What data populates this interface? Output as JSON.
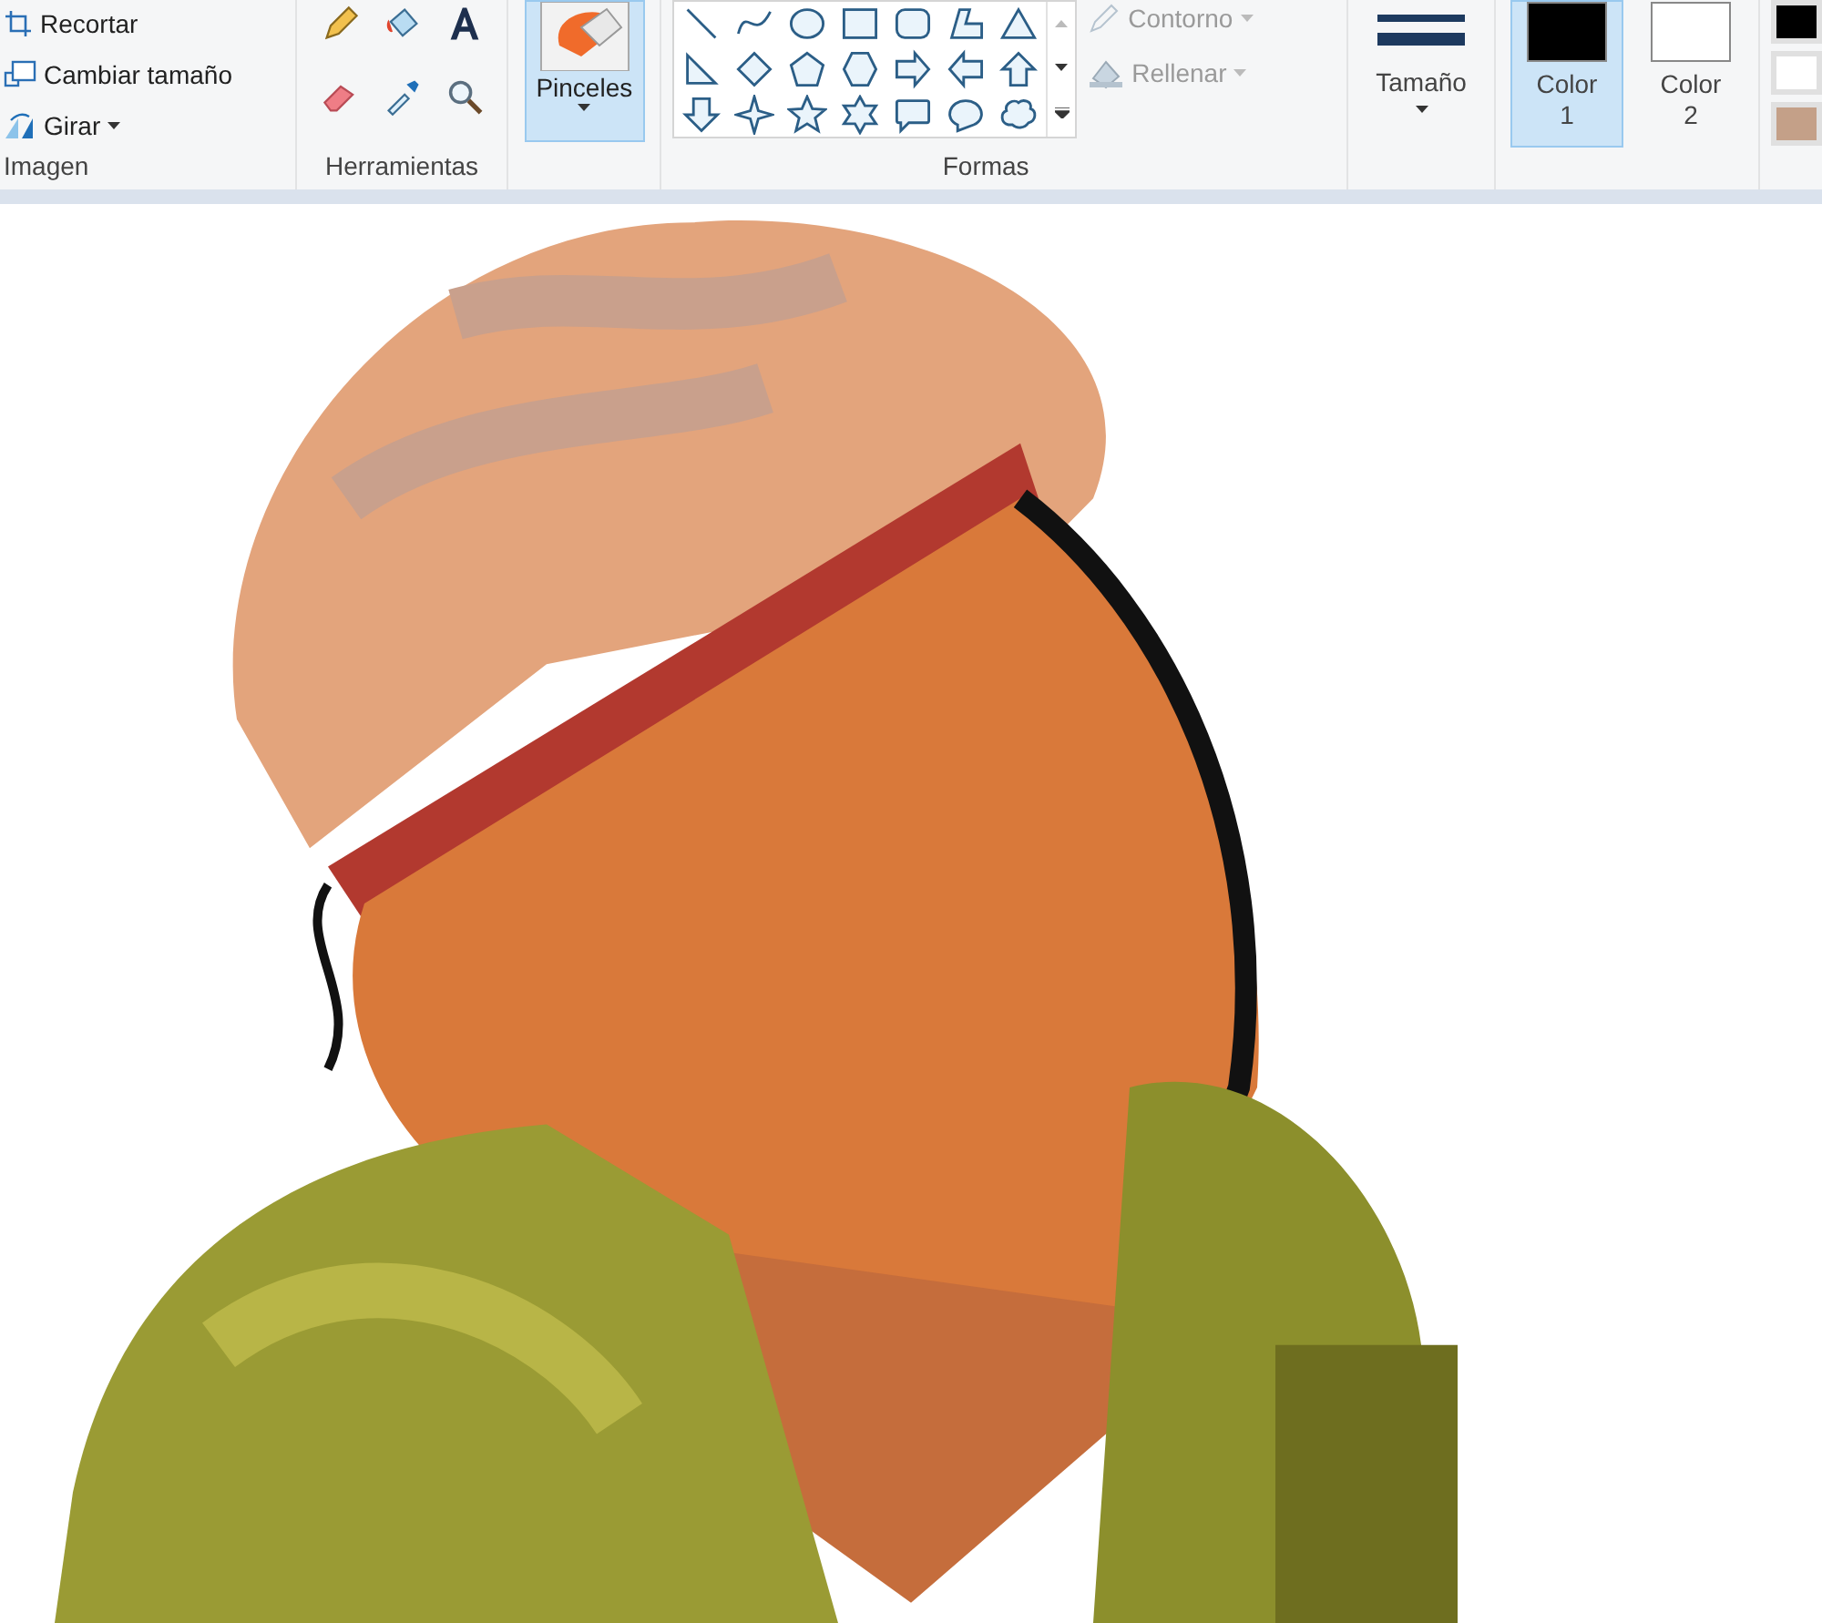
{
  "ribbon": {
    "imagen": {
      "label": "Imagen",
      "items": [
        {
          "kind": "crop",
          "label": "Recortar"
        },
        {
          "kind": "resize",
          "label": "Cambiar tamaño"
        },
        {
          "kind": "rotate",
          "label": "Girar",
          "dropdown": true
        }
      ]
    },
    "herramientas": {
      "label": "Herramientas"
    },
    "brushes": {
      "label": "Pinceles",
      "selected": true
    },
    "formas": {
      "label": "Formas",
      "outline": {
        "label": "Contorno",
        "disabled": true
      },
      "fill": {
        "label": "Rellenar",
        "disabled": true
      }
    },
    "size": {
      "label": "Tamaño"
    },
    "colors": [
      {
        "label": "Color",
        "number": "1",
        "color": "#000000",
        "selected": true
      },
      {
        "label": "Color",
        "number": "2",
        "color": "#ffffff",
        "selected": false
      }
    ],
    "palette": [
      {
        "color": "#000000"
      },
      {
        "color": "#ffffff"
      },
      {
        "color": "#c4a088"
      }
    ]
  }
}
